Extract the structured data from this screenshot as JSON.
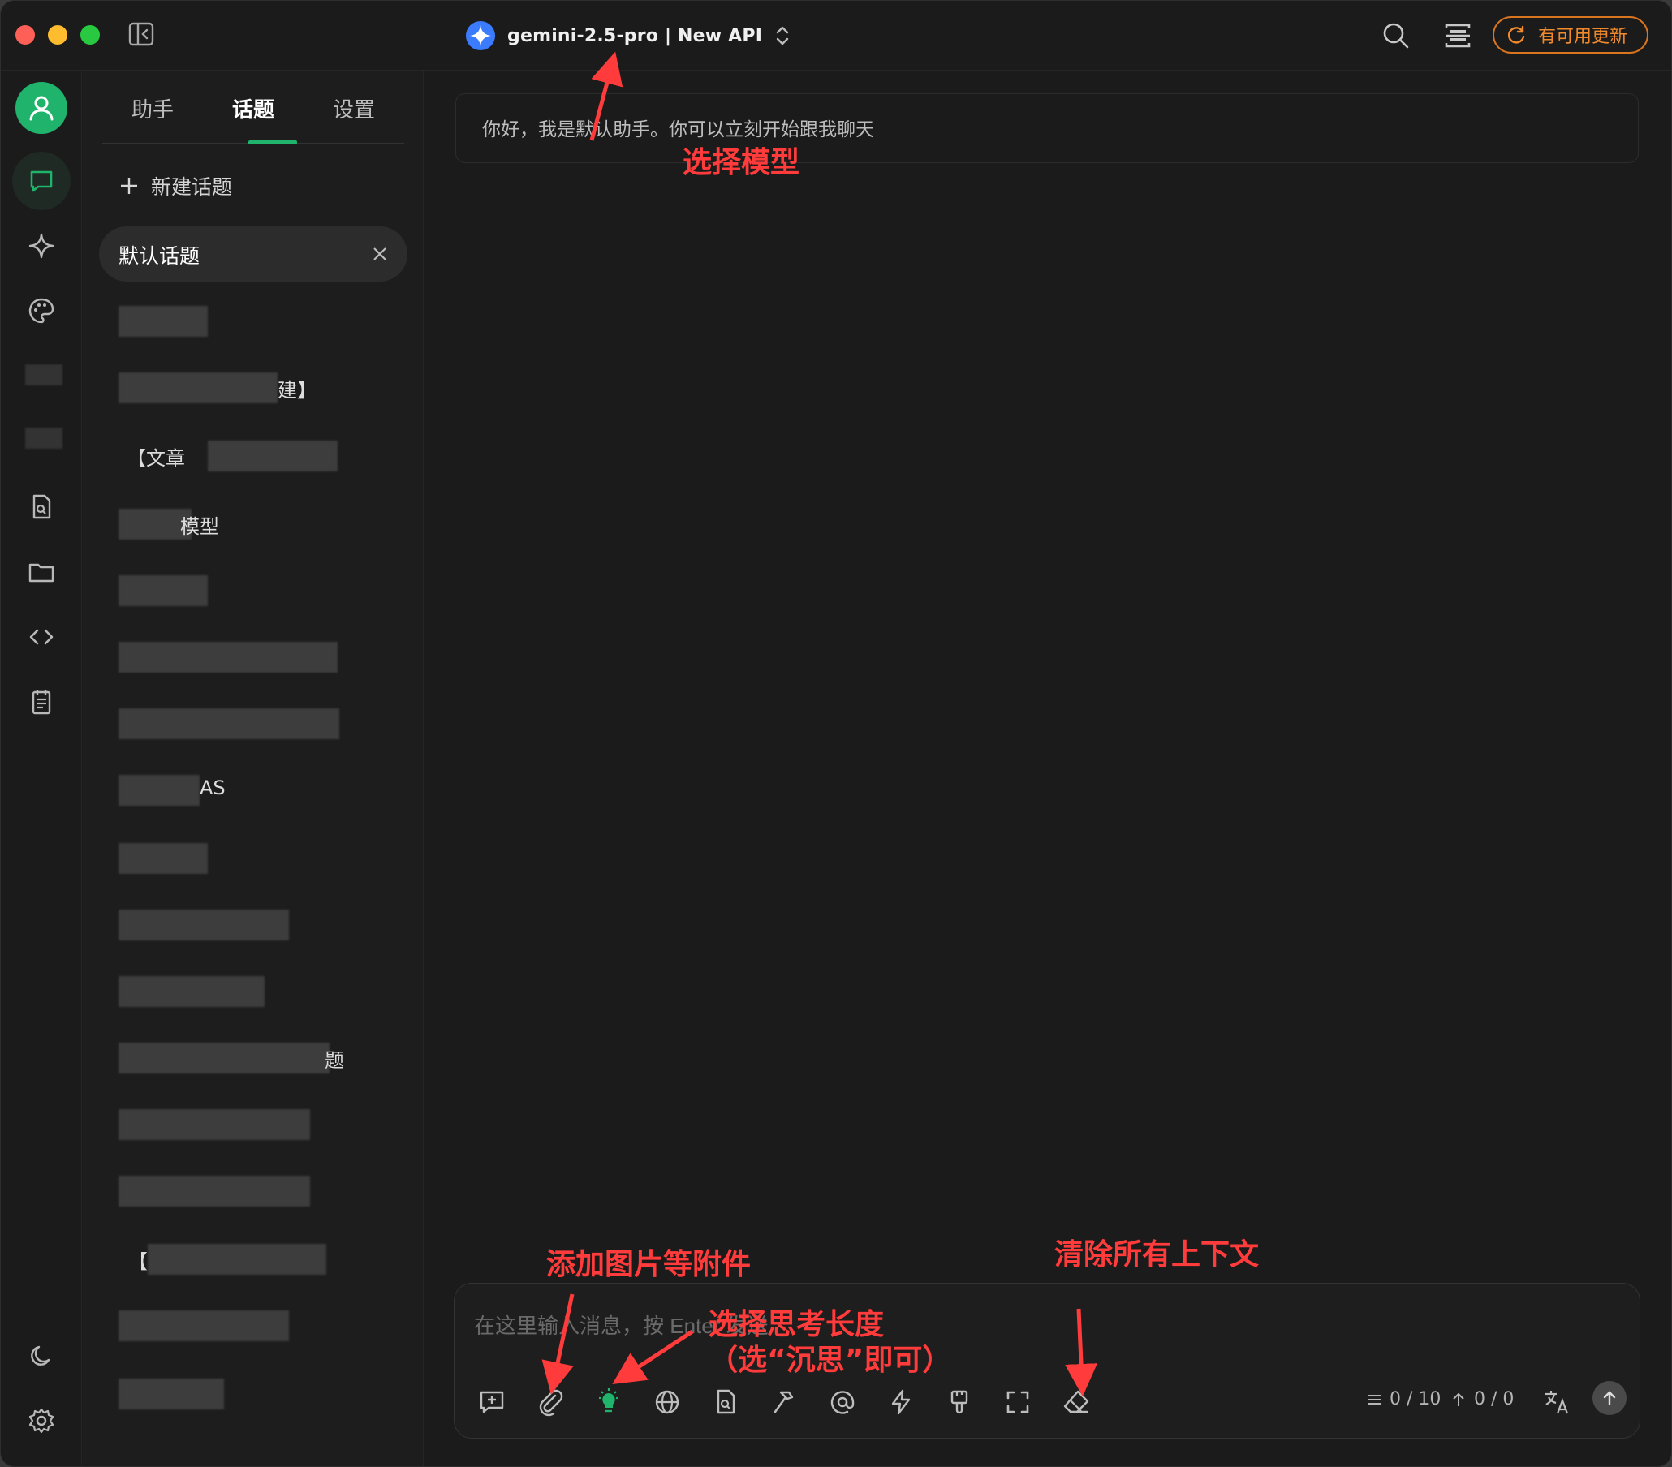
{
  "titlebar": {
    "model_label": "gemini-2.5-pro | New API",
    "update_label": "有可用更新"
  },
  "topics_panel": {
    "tabs": [
      "助手",
      "话题",
      "设置"
    ],
    "active_tab": "话题",
    "new_topic_label": "新建话题",
    "active_topic": "默认话题",
    "visible_fragments": [
      "建】",
      "【文章",
      "模型",
      "AS",
      "题",
      "【"
    ]
  },
  "chat": {
    "greeting": "你好，我是默认助手。你可以立刻开始跟我聊天",
    "input_placeholder": "在这里输入消息，按 Enter 发送",
    "context_counter": "0 / 10",
    "token_counter": "0 / 0"
  },
  "annotations": {
    "select_model": "选择模型",
    "add_attachment": "添加图片等附件",
    "select_thinking_line1": "选择思考长度",
    "select_thinking_line2": "（选“沉思”即可）",
    "clear_context": "清除所有上下文"
  },
  "colors": {
    "accent": "#1fb36b",
    "update_orange": "#f08a2c",
    "annotation_red": "#ff3b3b",
    "bg": "#1b1b1b"
  }
}
